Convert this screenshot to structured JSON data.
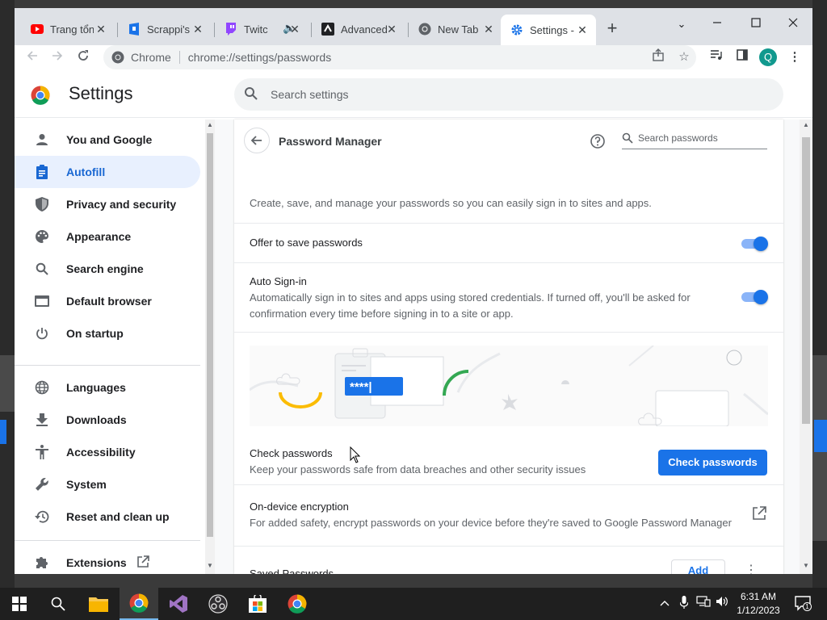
{
  "browser": {
    "tabs": [
      {
        "title": "Trang tổng",
        "favicon": "youtube-icon"
      },
      {
        "title": "Scrappi's",
        "favicon": "scrappi-icon"
      },
      {
        "title": "Twitch",
        "favicon": "twitch-icon"
      },
      {
        "title": "Advanced",
        "favicon": "advanced-icon"
      },
      {
        "title": "New Tab",
        "favicon": "chrome-icon"
      },
      {
        "title": "Settings -",
        "favicon": "settings-gear-icon"
      }
    ],
    "omnibox": {
      "chip": "Chrome",
      "url": "chrome://settings/passwords"
    },
    "profile_initial": "Q"
  },
  "settings": {
    "title": "Settings",
    "search_placeholder": "Search settings"
  },
  "sidebar": {
    "items": [
      {
        "label": "You and Google",
        "icon": "person-icon"
      },
      {
        "label": "Autofill",
        "icon": "clipboard-icon"
      },
      {
        "label": "Privacy and security",
        "icon": "shield-icon"
      },
      {
        "label": "Appearance",
        "icon": "palette-icon"
      },
      {
        "label": "Search engine",
        "icon": "search-icon"
      },
      {
        "label": "Default browser",
        "icon": "browser-icon"
      },
      {
        "label": "On startup",
        "icon": "power-icon"
      },
      {
        "label": "Languages",
        "icon": "globe-icon"
      },
      {
        "label": "Downloads",
        "icon": "download-icon"
      },
      {
        "label": "Accessibility",
        "icon": "accessibility-icon"
      },
      {
        "label": "System",
        "icon": "wrench-icon"
      },
      {
        "label": "Reset and clean up",
        "icon": "restore-icon"
      },
      {
        "label": "Extensions",
        "icon": "puzzle-icon"
      }
    ]
  },
  "password_manager": {
    "title": "Password Manager",
    "search_placeholder": "Search passwords",
    "description": "Create, save, and manage your passwords so you can easily sign in to sites and apps.",
    "offer_to_save": {
      "label": "Offer to save passwords",
      "enabled": true
    },
    "auto_signin": {
      "label": "Auto Sign-in",
      "description_line1": "Automatically sign in to sites and apps using stored credentials. If turned off, you'll be asked for",
      "description_line2": "confirmation every time before signing in to a site or app.",
      "enabled": true
    },
    "illustration_text": "****|",
    "check_passwords": {
      "title": "Check passwords",
      "description": "Keep your passwords safe from data breaches and other security issues",
      "button": "Check passwords"
    },
    "on_device_encryption": {
      "title": "On-device encryption",
      "description": "For added safety, encrypt passwords on your device before they're saved to Google Password Manager"
    },
    "saved_passwords": {
      "title": "Saved Passwords",
      "add_button": "Add"
    }
  },
  "taskbar": {
    "time": "6:31 AM",
    "date": "1/12/2023",
    "notification_count": "1"
  },
  "colors": {
    "accent": "#1a73e8",
    "active_bg": "#e8f0fe",
    "active_text": "#1967d2"
  }
}
